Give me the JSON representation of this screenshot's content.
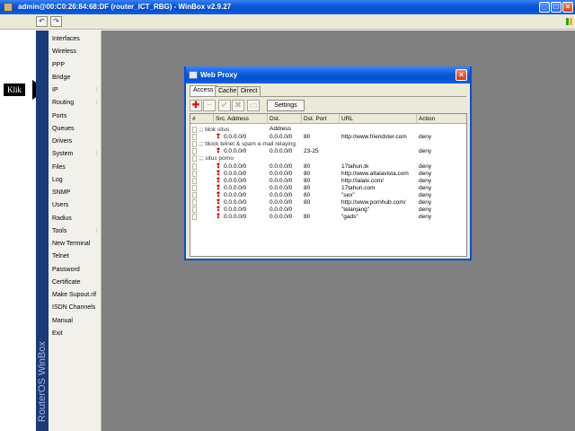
{
  "window": {
    "title": "admin@00:C0:26:84:68:DF (router_ICT_RBG) - WinBox v2.9.27"
  },
  "annotation": {
    "label": "Klik"
  },
  "brand": "RouterOS WinBox",
  "menu": [
    {
      "label": "Interfaces"
    },
    {
      "label": "Wireless"
    },
    {
      "label": "PPP"
    },
    {
      "label": "Bridge"
    },
    {
      "label": "IP",
      "sub": "⁝"
    },
    {
      "label": "Routing",
      "sub": "⁝"
    },
    {
      "label": "Ports"
    },
    {
      "label": "Queues"
    },
    {
      "label": "Drivers"
    },
    {
      "label": "System",
      "sub": "⁝"
    },
    {
      "label": "Files"
    },
    {
      "label": "Log"
    },
    {
      "label": "SNMP"
    },
    {
      "label": "Users"
    },
    {
      "label": "Radius"
    },
    {
      "label": "Tools",
      "sub": "⁝"
    },
    {
      "label": "New Terminal"
    },
    {
      "label": "Telnet"
    },
    {
      "label": "Password"
    },
    {
      "label": "Certificate"
    },
    {
      "label": "Make Supout.rif"
    },
    {
      "label": "ISDN Channels"
    },
    {
      "label": "Manual"
    },
    {
      "label": "Exit"
    }
  ],
  "web_proxy": {
    "title": "Web Proxy",
    "tabs": [
      "Access",
      "Cache",
      "Direct"
    ],
    "settings_label": "Settings",
    "columns": [
      "#",
      "Src. Address",
      "Dst. Address",
      "Dst. Port",
      "URL",
      "Action"
    ],
    "rows": [
      {
        "comment": ";;; blok situs"
      },
      {
        "src": "0.0.0.0/0",
        "dst": "0.0.0.0/0",
        "port": "80",
        "url": "http://www.friendster.com",
        "action": "deny"
      },
      {
        "comment": ";;; block telnet & spam e-mail relaying"
      },
      {
        "src": "0.0.0.0/0",
        "dst": "0.0.0.0/0",
        "port": "23-25",
        "url": "",
        "action": "deny"
      },
      {
        "comment": ";;; situs porno"
      },
      {
        "src": "0.0.0.0/0",
        "dst": "0.0.0.0/0",
        "port": "80",
        "url": "17tahun.tk",
        "action": "deny"
      },
      {
        "src": "0.0.0.0/0",
        "dst": "0.0.0.0/0",
        "port": "80",
        "url": "http://www.altalavista.com",
        "action": "deny"
      },
      {
        "src": "0.0.0.0/0",
        "dst": "0.0.0.0/0",
        "port": "80",
        "url": "http://lalalx.com/",
        "action": "deny"
      },
      {
        "src": "0.0.0.0/0",
        "dst": "0.0.0.0/0",
        "port": "80",
        "url": "17tahun.com",
        "action": "deny"
      },
      {
        "src": "0.0.0.0/0",
        "dst": "0.0.0.0/0",
        "port": "80",
        "url": "\"sex\"",
        "action": "deny"
      },
      {
        "src": "0.0.0.0/0",
        "dst": "0.0.0.0/0",
        "port": "80",
        "url": "http://www.pornhub.com/",
        "action": "deny"
      },
      {
        "src": "0.0.0.0/0",
        "dst": "0.0.0.0/0",
        "port": "",
        "url": "\"telanjang\"",
        "action": "deny"
      },
      {
        "src": "0.0.0.0/0",
        "dst": "0.0.0.0/0",
        "port": "80",
        "url": "\"gads\"",
        "action": "deny"
      }
    ]
  },
  "colors": {
    "titlebar": "#0a58d8",
    "desktop": "#808080",
    "brand_bar": "#1d3a78",
    "add_icon": "#dd1111"
  }
}
